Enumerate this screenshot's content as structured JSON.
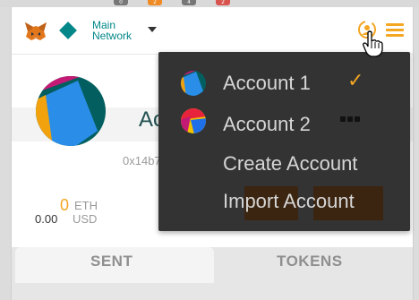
{
  "header": {
    "network_line1": "Main",
    "network_line2": "Network",
    "colors": {
      "network": "#038789",
      "accent": "#f5a623"
    }
  },
  "account": {
    "name": "Account 2",
    "address": "0x14b7E...",
    "balance_eth_value": "0",
    "balance_eth_unit": "ETH",
    "balance_usd_value": "0.00",
    "balance_usd_unit": "USD"
  },
  "tabs": [
    {
      "label": "SENT",
      "active": true
    },
    {
      "label": "TOKENS",
      "active": false
    }
  ],
  "menu": {
    "items": [
      {
        "label": "Account 1",
        "checked": true
      },
      {
        "label": "Account 2",
        "checked": false
      },
      {
        "label": "Create Account"
      },
      {
        "label": "Import Account"
      }
    ],
    "check_glyph": "✓"
  },
  "browser_badges": [
    "0",
    "2",
    "4",
    "2"
  ]
}
